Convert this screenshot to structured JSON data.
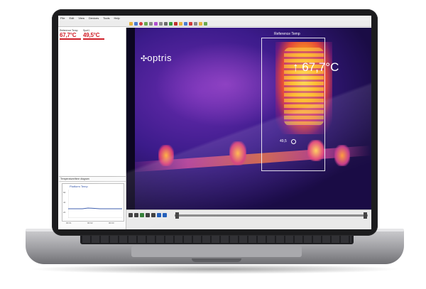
{
  "menu": [
    "File",
    "Edit",
    "View",
    "Devices",
    "Tools",
    "Help"
  ],
  "toolbar_icons": [
    "open-icon",
    "save-icon",
    "record-icon",
    "snapshot-icon",
    "zoom-icon",
    "palette-icon",
    "settings-icon",
    "grid-icon",
    "play-icon",
    "stop-icon"
  ],
  "left_panel": {
    "measure_1": {
      "label": "Reference Temp",
      "value": "67,7°C"
    },
    "measure_2": {
      "label": "Spot1",
      "value": "49,5°C"
    },
    "chart": {
      "title": "Temperature/time diagram",
      "legend": "Platform Temp",
      "y_ticks": [
        "60",
        "40",
        "20"
      ],
      "x_ticks": [
        "00:01",
        "00:02",
        "00:03"
      ],
      "line_color": "#3355aa"
    }
  },
  "thermal": {
    "brand": "optris",
    "max_temp": "↑ 67,7°C",
    "spot_temp": "49,5",
    "roi_label": "Reference Temp"
  },
  "colors": {
    "accent_red": "#d0202a",
    "bezel": "#1c1c1e",
    "thermal_bg": "#160b3a"
  }
}
